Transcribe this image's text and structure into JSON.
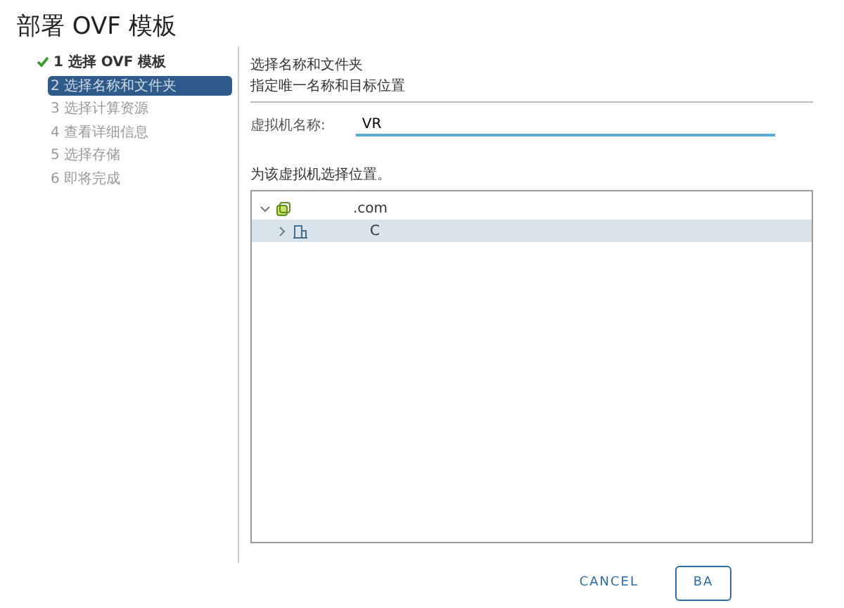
{
  "window": {
    "title": "部署 OVF 模板"
  },
  "steps": [
    {
      "label": "1 选择 OVF 模板",
      "done": true,
      "selected": false
    },
    {
      "label": "2 选择名称和文件夹",
      "done": false,
      "selected": true
    },
    {
      "label": "3 选择计算资源",
      "done": false,
      "selected": false
    },
    {
      "label": "4 查看详细信息",
      "done": false,
      "selected": false
    },
    {
      "label": "5 选择存储",
      "done": false,
      "selected": false
    },
    {
      "label": "6 即将完成",
      "done": false,
      "selected": false
    }
  ],
  "page": {
    "title": "选择名称和文件夹",
    "subtitle": "指定唯一名称和目标位置"
  },
  "name_field": {
    "label": "虚拟机名称:",
    "value": "VR"
  },
  "location_label": "为该虚拟机选择位置。",
  "tree": [
    {
      "label": ".com",
      "kind": "vcenter",
      "expanded": true,
      "selected": false,
      "children": [
        {
          "label": "C",
          "kind": "datacenter",
          "expanded": false,
          "selected": true
        }
      ]
    }
  ],
  "buttons": [
    {
      "label": "CANCEL",
      "kind": "flat"
    },
    {
      "label": "BA",
      "kind": "outline"
    }
  ]
}
